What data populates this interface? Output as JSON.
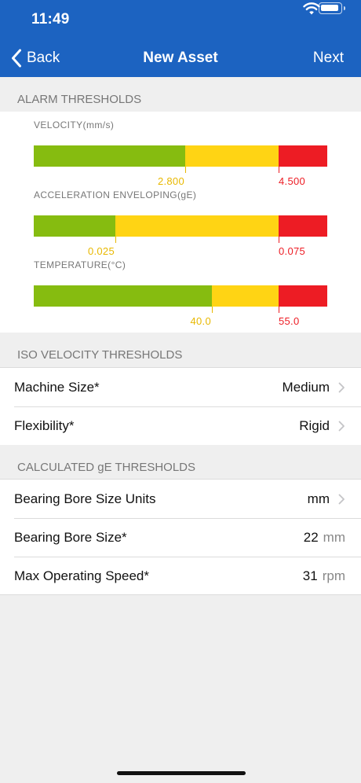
{
  "status_bar": {
    "time": "11:49"
  },
  "nav": {
    "back_label": "Back",
    "title": "New Asset",
    "next_label": "Next"
  },
  "alarm": {
    "header": "ALARM THRESHOLDS",
    "gauges": [
      {
        "label": "VELOCITY(mm/s)",
        "warning": "2.800",
        "alarm": "4.500",
        "green_fraction": 0.517,
        "yellow_fraction": 0.318,
        "red_fraction": 0.165
      },
      {
        "label": "ACCELERATION ENVELOPING(gE)",
        "warning": "0.025",
        "alarm": "0.075",
        "green_fraction": 0.278,
        "yellow_fraction": 0.557,
        "red_fraction": 0.165
      },
      {
        "label": "TEMPERATURE(°C)",
        "warning": "40.0",
        "alarm": "55.0",
        "green_fraction": 0.607,
        "yellow_fraction": 0.228,
        "red_fraction": 0.165
      }
    ],
    "colors": {
      "ok": "#86bc10",
      "warning": "#ffd414",
      "alarm": "#ed1c24"
    }
  },
  "iso": {
    "header": "ISO VELOCITY THRESHOLDS",
    "machine_size": {
      "label": "Machine Size*",
      "value": "Medium"
    },
    "flexibility": {
      "label": "Flexibility*",
      "value": "Rigid"
    }
  },
  "ge": {
    "header": "CALCULATED gE THRESHOLDS",
    "bore_units": {
      "label": "Bearing Bore Size Units",
      "value": "mm"
    },
    "bore_size": {
      "label": "Bearing Bore Size*",
      "value": "22",
      "unit": "mm"
    },
    "max_speed": {
      "label": "Max Operating Speed*",
      "value": "31",
      "unit": "rpm"
    }
  },
  "theme": {
    "nav_color": "#1c63c1"
  }
}
